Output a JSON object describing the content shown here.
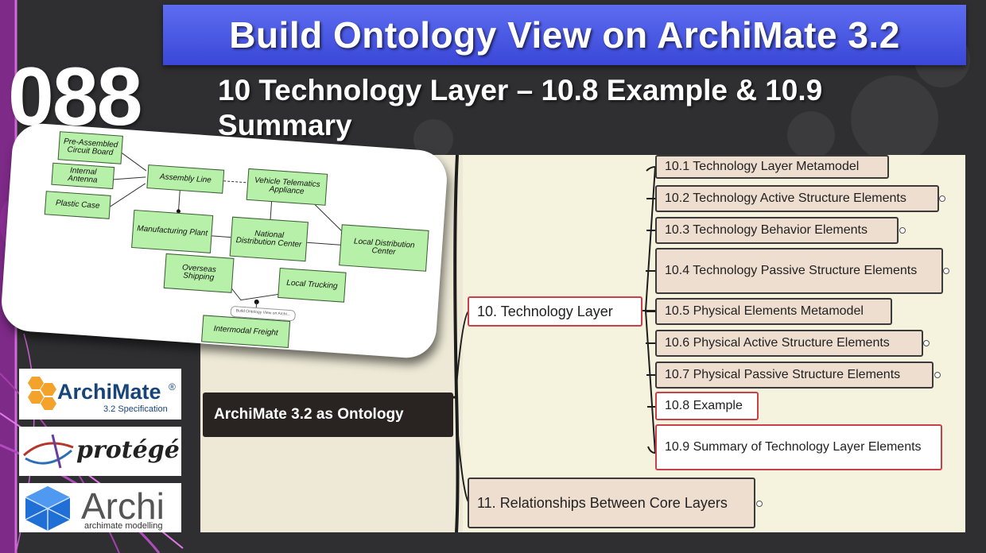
{
  "title": "Build Ontology View on ArchiMate 3.2",
  "episode": "088",
  "subtitle": "10 Technology Layer – 10.8 Example & 10.9 Summary",
  "mindmap": {
    "root": "ArchiMate 3.2 as Ontology",
    "branches": [
      {
        "label": "10. Technology Layer",
        "children": [
          "10.1 Technology Layer Metamodel",
          "10.2 Technology Active Structure Elements",
          "10.3 Technology Behavior Elements",
          "10.4 Technology Passive Structure Elements",
          "10.5 Physical Elements Metamodel",
          "10.6 Physical Active Structure Elements",
          "10.7 Physical Passive Structure Elements",
          "10.8 Example",
          "10.9 Summary of Technology Layer Elements"
        ]
      },
      {
        "label": "11. Relationships Between Core Layers"
      }
    ]
  },
  "diagram": {
    "elements": [
      "Pre-Assembled Circuit Board",
      "Internal Antenna",
      "Plastic Case",
      "Assembly Line",
      "Vehicle Telematics Appliance",
      "Manufacturing Plant",
      "National Distribution Center",
      "Local Distribution Center",
      "Overseas Shipping",
      "Local Trucking",
      "Intermodal Freight"
    ],
    "tag": "Build Ontology View on Archi..."
  },
  "logos": {
    "archimate": {
      "name": "ArchiMate",
      "reg": "®",
      "sub": "3.2 Specification"
    },
    "protege": {
      "name": "protégé"
    },
    "archi": {
      "name": "Archi",
      "sub": "archimate modelling"
    }
  }
}
